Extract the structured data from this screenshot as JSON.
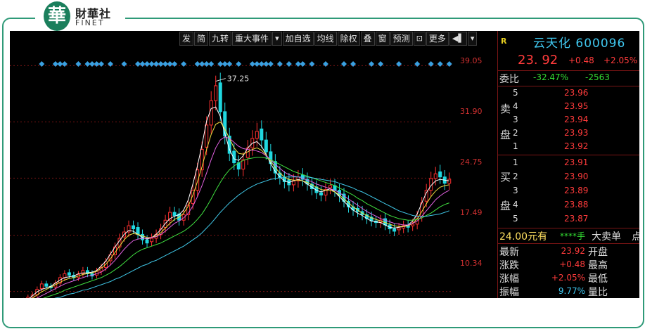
{
  "brand": {
    "logo_glyph": "華",
    "name_cn": "財華社",
    "name_en": "FINET"
  },
  "toolbar": {
    "buttons": [
      "发",
      "简",
      "九转",
      "重大事件"
    ],
    "buttons2": [
      "加自选",
      "均线",
      "除权",
      "叠",
      "窗",
      "预测",
      "更多"
    ],
    "dropdown_icon": "chevron-down-icon",
    "exit_icon": "exit-icon"
  },
  "price_axis": {
    "ticks": [
      "39.05",
      "31.90",
      "24.75",
      "17.49",
      "10.34"
    ]
  },
  "chart_data": {
    "type": "candlestick",
    "ylim": [
      9.5,
      41.5
    ],
    "annotation": "37.25",
    "annotation_value": 37.25,
    "closes": [
      8.6,
      8.9,
      9.2,
      9.6,
      9.9,
      10.6,
      11.3,
      11.0,
      10.8,
      11.4,
      12.1,
      12.6,
      12.4,
      12.1,
      12.5,
      13.0,
      12.6,
      12.3,
      12.9,
      13.4,
      14.1,
      15.0,
      16.0,
      17.1,
      17.9,
      18.7,
      18.3,
      17.6,
      16.9,
      16.5,
      17.1,
      17.6,
      18.3,
      19.4,
      20.4,
      20.0,
      19.4,
      20.1,
      21.3,
      23.2,
      25.8,
      28.4,
      31.5,
      34.6,
      36.5,
      33.2,
      30.1,
      27.9,
      26.7,
      25.9,
      27.1,
      28.6,
      29.8,
      30.7,
      29.6,
      28.1,
      26.6,
      25.4,
      24.8,
      24.3,
      23.9,
      24.4,
      24.9,
      24.6,
      24.0,
      23.4,
      22.9,
      22.6,
      23.3,
      23.8,
      23.2,
      22.5,
      21.8,
      21.1,
      20.7,
      20.5,
      20.1,
      19.6,
      19.3,
      19.1,
      19.4,
      18.8,
      18.3,
      18.0,
      18.4,
      18.7,
      18.5,
      18.9,
      19.9,
      21.6,
      23.2,
      24.7,
      25.3,
      24.9,
      24.1,
      24.6
    ],
    "ma": [
      {
        "color": "#ffffff",
        "values": [
          8.6,
          8.8,
          9.0,
          9.3,
          9.8,
          10.3,
          10.6,
          10.8,
          11.0,
          11.4,
          11.8,
          12.1,
          12.2,
          12.3,
          12.6,
          12.7,
          12.7,
          12.8,
          13.0,
          13.6,
          14.2,
          15.1,
          16.0,
          16.8,
          17.6,
          18.1,
          18.0,
          17.6,
          17.2,
          17.0,
          17.2,
          17.6,
          18.2,
          19.0,
          19.6,
          19.9,
          20.1,
          20.7,
          22.0,
          24.0,
          26.3,
          29.0,
          32.0,
          33.6,
          33.8,
          32.6,
          30.4,
          28.4,
          27.2,
          27.0,
          27.6,
          28.6,
          29.2,
          29.4,
          28.8,
          27.8,
          26.6,
          25.6,
          24.9,
          24.4,
          24.2,
          24.4,
          24.6,
          24.4,
          24.0,
          23.6,
          23.2,
          23.0,
          23.2,
          23.4,
          23.0,
          22.4,
          21.8,
          21.2,
          20.7,
          20.3,
          20.0,
          19.6,
          19.3,
          19.2,
          19.1,
          18.8,
          18.5,
          18.4,
          18.5,
          18.6,
          18.8,
          19.3,
          20.2,
          21.6,
          22.9,
          23.8,
          24.4,
          24.6,
          24.5,
          24.4
        ]
      },
      {
        "color": "#f0e040",
        "values": [
          8.6,
          8.7,
          8.9,
          9.1,
          9.5,
          9.9,
          10.3,
          10.6,
          10.9,
          11.2,
          11.5,
          11.8,
          12.0,
          12.1,
          12.3,
          12.5,
          12.6,
          12.7,
          12.9,
          13.3,
          13.8,
          14.5,
          15.3,
          16.1,
          16.9,
          17.5,
          17.7,
          17.6,
          17.4,
          17.2,
          17.2,
          17.4,
          17.8,
          18.4,
          19.0,
          19.5,
          19.8,
          20.3,
          21.2,
          22.6,
          24.3,
          26.2,
          28.4,
          30.3,
          31.6,
          31.9,
          31.0,
          29.8,
          28.6,
          27.9,
          27.8,
          28.1,
          28.4,
          28.6,
          28.3,
          27.7,
          26.9,
          26.1,
          25.4,
          24.9,
          24.6,
          24.5,
          24.5,
          24.4,
          24.2,
          23.9,
          23.6,
          23.3,
          23.2,
          23.2,
          23.0,
          22.6,
          22.1,
          21.6,
          21.1,
          20.7,
          20.3,
          20.0,
          19.7,
          19.5,
          19.3,
          19.1,
          18.9,
          18.7,
          18.6,
          18.6,
          18.7,
          19.0,
          19.6,
          20.5,
          21.5,
          22.4,
          23.1,
          23.6,
          23.8,
          23.9
        ]
      },
      {
        "color": "#e060e0",
        "values": [
          8.6,
          8.7,
          8.8,
          9.0,
          9.2,
          9.5,
          9.8,
          10.1,
          10.4,
          10.7,
          11.0,
          11.3,
          11.5,
          11.7,
          11.9,
          12.1,
          12.3,
          12.4,
          12.6,
          12.8,
          13.2,
          13.7,
          14.3,
          15.0,
          15.7,
          16.3,
          16.8,
          17.0,
          17.1,
          17.1,
          17.2,
          17.3,
          17.6,
          18.0,
          18.5,
          19.0,
          19.3,
          19.7,
          20.3,
          21.2,
          22.4,
          23.8,
          25.4,
          27.1,
          28.6,
          29.6,
          30.0,
          29.8,
          29.3,
          28.8,
          28.5,
          28.4,
          28.3,
          28.2,
          28.0,
          27.6,
          27.1,
          26.5,
          26.0,
          25.5,
          25.2,
          25.0,
          24.9,
          24.7,
          24.5,
          24.3,
          24.0,
          23.8,
          23.6,
          23.4,
          23.2,
          22.9,
          22.5,
          22.1,
          21.7,
          21.3,
          20.9,
          20.5,
          20.2,
          19.9,
          19.6,
          19.4,
          19.2,
          19.0,
          18.9,
          18.8,
          18.8,
          19.0,
          19.3,
          19.9,
          20.6,
          21.3,
          22.0,
          22.5,
          22.9,
          23.2
        ]
      },
      {
        "color": "#40e040",
        "values": [
          8.6,
          8.6,
          8.7,
          8.8,
          9.0,
          9.2,
          9.4,
          9.6,
          9.8,
          10.0,
          10.2,
          10.5,
          10.7,
          10.9,
          11.1,
          11.3,
          11.5,
          11.7,
          11.9,
          12.1,
          12.4,
          12.7,
          13.1,
          13.5,
          14.0,
          14.5,
          15.0,
          15.4,
          15.7,
          15.9,
          16.1,
          16.3,
          16.5,
          16.8,
          17.1,
          17.4,
          17.7,
          18.0,
          18.4,
          18.9,
          19.5,
          20.2,
          21.1,
          22.1,
          23.2,
          24.2,
          25.1,
          25.8,
          26.3,
          26.7,
          27.0,
          27.2,
          27.3,
          27.4,
          27.4,
          27.3,
          27.1,
          26.8,
          26.5,
          26.2,
          25.9,
          25.6,
          25.4,
          25.2,
          25.0,
          24.8,
          24.6,
          24.4,
          24.2,
          24.0,
          23.8,
          23.5,
          23.2,
          22.9,
          22.6,
          22.2,
          21.9,
          21.5,
          21.2,
          20.9,
          20.6,
          20.3,
          20.0,
          19.8,
          19.6,
          19.5,
          19.4,
          19.4,
          19.5,
          19.7,
          20.0,
          20.3,
          20.7,
          21.1,
          21.4,
          21.6
        ]
      },
      {
        "color": "#40c8e8",
        "values": [
          8.6,
          8.6,
          8.6,
          8.7,
          8.8,
          8.9,
          9.0,
          9.2,
          9.3,
          9.5,
          9.6,
          9.8,
          10.0,
          10.1,
          10.3,
          10.5,
          10.6,
          10.8,
          11.0,
          11.2,
          11.4,
          11.6,
          11.9,
          12.1,
          12.4,
          12.7,
          13.0,
          13.3,
          13.6,
          13.8,
          14.1,
          14.3,
          14.6,
          14.9,
          15.2,
          15.5,
          15.8,
          16.1,
          16.5,
          16.9,
          17.3,
          17.8,
          18.4,
          19.0,
          19.7,
          20.4,
          21.0,
          21.6,
          22.1,
          22.6,
          23.0,
          23.4,
          23.7,
          24.0,
          24.2,
          24.4,
          24.6,
          24.7,
          24.8,
          24.9,
          24.9,
          24.9,
          24.9,
          24.9,
          24.9,
          24.8,
          24.7,
          24.6,
          24.5,
          24.4,
          24.3,
          24.1,
          23.9,
          23.7,
          23.5,
          23.2,
          23.0,
          22.7,
          22.4,
          22.1,
          21.8,
          21.5,
          21.2,
          20.9,
          20.6,
          20.4,
          20.2,
          20.0,
          19.9,
          19.9,
          19.9,
          20.0,
          20.1,
          20.2,
          20.4,
          20.6
        ]
      }
    ],
    "markers": [
      6,
      9,
      10,
      11,
      14,
      16,
      17,
      18,
      19,
      21,
      24,
      27,
      28,
      29,
      30,
      31,
      32,
      33,
      34,
      35,
      37,
      40,
      41,
      42,
      43,
      45,
      46,
      47,
      49,
      52,
      53,
      54,
      55,
      56,
      58,
      60,
      62,
      63,
      65,
      68,
      72,
      74,
      78,
      80,
      84,
      88,
      91,
      93,
      95
    ]
  },
  "quote": {
    "r_badge": "R",
    "name_code": "云天化 600096",
    "price": "23. 92",
    "change": "+0.48",
    "change_pct": "+2.05%",
    "weibi_label": "委比",
    "weibi_pct": "-32.47%",
    "weibi_diff": "-2563",
    "sell_chars": [
      "卖",
      "盘"
    ],
    "buy_chars": [
      "买",
      "盘"
    ],
    "sells": [
      {
        "level": "5",
        "price": "23.96"
      },
      {
        "level": "4",
        "price": "23.95"
      },
      {
        "level": "3",
        "price": "23.94"
      },
      {
        "level": "2",
        "price": "23.93"
      },
      {
        "level": "1",
        "price": "23.92"
      }
    ],
    "buys": [
      {
        "level": "1",
        "price": "23.91"
      },
      {
        "level": "2",
        "price": "23.90"
      },
      {
        "level": "3",
        "price": "23.89"
      },
      {
        "level": "4",
        "price": "23.88"
      },
      {
        "level": "5",
        "price": "23.87"
      }
    ],
    "bigorder": {
      "price_label": "24.00元有",
      "stars": "****手",
      "tag": "大卖单",
      "dot": "点"
    },
    "stats": [
      {
        "label": "最新",
        "value": "23.92",
        "label2": "开盘"
      },
      {
        "label": "涨跌",
        "value": "+0.48",
        "label2": "最高"
      },
      {
        "label": "涨幅",
        "value": "+2.05%",
        "label2": "最低"
      },
      {
        "label": "振幅",
        "value": "9.77%",
        "label2": "量比"
      }
    ],
    "colors": {
      "up": "#ff3b3b",
      "down": "#33dd33",
      "name": "#40c8f0"
    }
  }
}
